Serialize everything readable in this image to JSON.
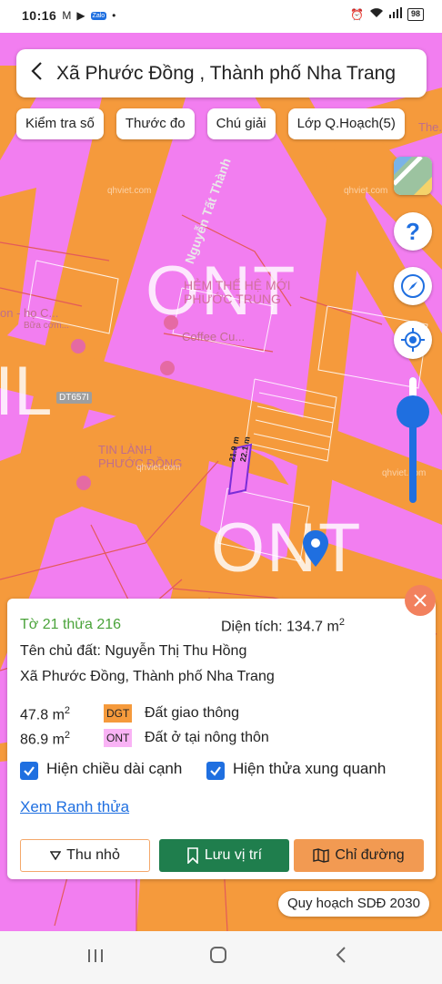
{
  "status_bar": {
    "time": "10:16",
    "battery": "98"
  },
  "header": {
    "back_icon": "chevron-left-icon",
    "title": "Xã Phước Đồng , Thành phố Nha Trang"
  },
  "toolbar": [
    {
      "label": "Kiểm tra số"
    },
    {
      "label": "Thước đo"
    },
    {
      "label": "Chú giải"
    },
    {
      "label": "Lớp Q.Hoạch(5)"
    }
  ],
  "map": {
    "zone_labels": [
      "ONT",
      "ONT",
      "IL"
    ],
    "road_name": "Nguyễn Tất Thành",
    "road_code": "DT657I",
    "pois": [
      "HẺM THẾ HỆ MỚI\nPHƯỚC TRUNG",
      "Coffee Cu...",
      "TIN LÀNH\nPHƯỚC ĐỒNG",
      "on - họ C...",
      "Bữa cơm...",
      "The..."
    ],
    "watermark": "qhviet.com",
    "dimensions": [
      "21.9 m",
      "22.1 m"
    ],
    "colors": {
      "residential": "#f27ef0",
      "road": "#f59a3c",
      "boundary": "#e35a5a"
    }
  },
  "controls": {
    "help_icon": "question-icon",
    "compass_icon": "compass-icon",
    "locate_icon": "locate-icon",
    "maps_icon": "google-maps-icon",
    "zoom_level": 0.85
  },
  "card": {
    "parcel": "Tờ 21 thửa 216",
    "area_label": "Diện tích: 134.7 m",
    "area_sup": "2",
    "owner": "Tên chủ đất: Nguyễn Thị Thu Hồng",
    "address": "Xã Phước Đồng, Thành phố Nha Trang",
    "landuse": [
      {
        "area": "47.8 m",
        "sup": "2",
        "code": "DGT",
        "name": "Đất giao thông",
        "color": "#f59a3c"
      },
      {
        "area": "86.9 m",
        "sup": "2",
        "code": "ONT",
        "name": "Đất ở tại nông thôn",
        "color": "#f9b3f5"
      }
    ],
    "checkbox_edges": "Hiện chiều dài cạnh",
    "checkbox_neighbors": "Hiện thửa xung quanh",
    "link": "Xem Ranh thửa",
    "btn_minimize": "Thu nhỏ",
    "btn_save": "Lưu vị trí",
    "btn_directions": "Chỉ đường"
  },
  "plan_label": "Quy hoạch SDĐ 2030"
}
